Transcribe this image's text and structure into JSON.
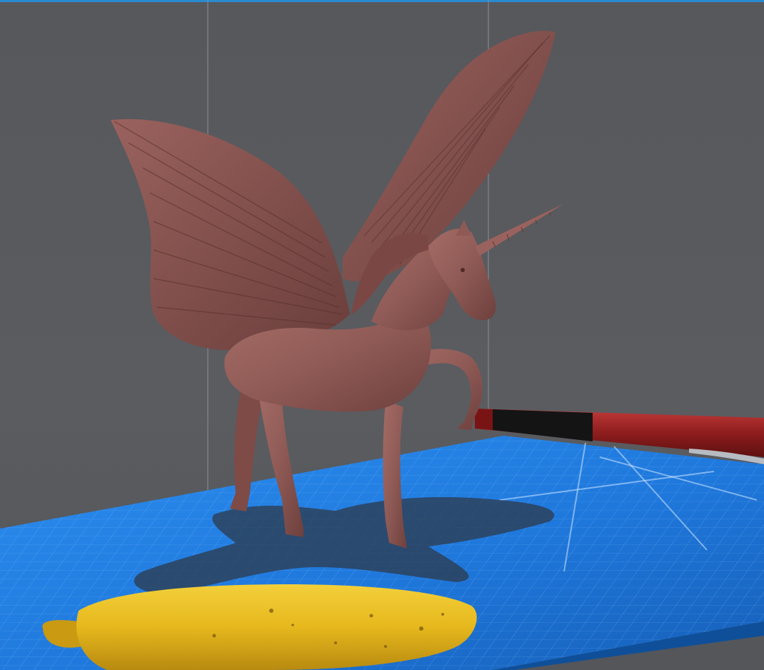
{
  "viewport": {
    "label": "",
    "background_color": "#57595d",
    "accent_edge_color": "#2a8ad0"
  },
  "scene": {
    "build_plate_color": "#1f7fe0",
    "build_plate_grid_color": "#9fd2ff",
    "model_color": "#8f5a56",
    "model_shadow_color": "#2e3a4a",
    "objects": [
      {
        "name": "winged-unicorn-model",
        "kind": "3d-model"
      },
      {
        "name": "banana",
        "kind": "reference-object"
      },
      {
        "name": "pen",
        "kind": "reference-object"
      }
    ]
  }
}
